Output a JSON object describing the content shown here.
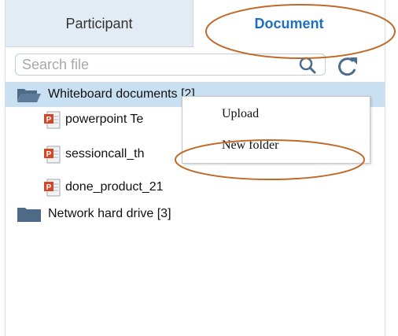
{
  "tabs": {
    "participant_label": "Participant",
    "document_label": "Document"
  },
  "search": {
    "placeholder": "Search file"
  },
  "tree": {
    "folders": [
      {
        "label": "Whiteboard documents [2]",
        "selected": true
      },
      {
        "label": "Network hard drive [3]",
        "selected": false
      }
    ],
    "files": [
      {
        "label": "powerpoint Te"
      },
      {
        "label": "sessioncall_th"
      },
      {
        "label": "done_product_21"
      }
    ]
  },
  "context_menu": {
    "items": [
      {
        "label": "Upload"
      },
      {
        "label": "New folder"
      }
    ]
  },
  "colors": {
    "accent": "#1f6fc0",
    "selected_row": "#c9dff2",
    "annotation": "#c06a2a",
    "folder": "#4e6a86"
  },
  "icons": [
    "search-icon",
    "refresh-icon",
    "folder-open-icon",
    "folder-icon",
    "powerpoint-icon"
  ]
}
